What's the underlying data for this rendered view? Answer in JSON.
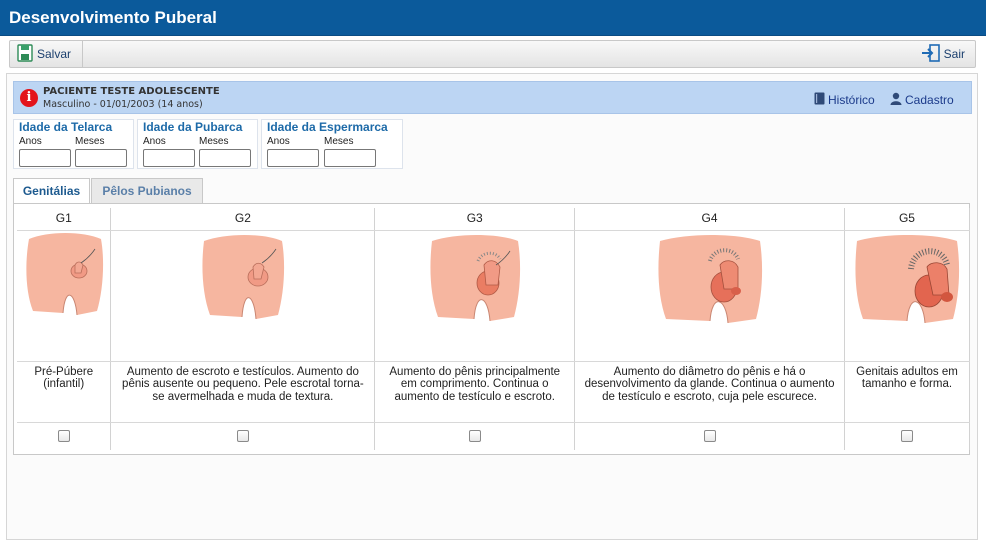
{
  "window": {
    "title": "Desenvolvimento Puberal"
  },
  "toolbar": {
    "save_label": "Salvar",
    "exit_label": "Sair"
  },
  "patient": {
    "name": "PACIENTE TESTE ADOLESCENTE",
    "details": "Masculino - 01/01/2003 (14 anos)",
    "history_label": "Histórico",
    "register_label": "Cadastro"
  },
  "ages": [
    {
      "legend": "Idade da Telarca",
      "years_label": "Anos",
      "months_label": "Meses",
      "years_value": "",
      "months_value": ""
    },
    {
      "legend": "Idade da Pubarca",
      "years_label": "Anos",
      "months_label": "Meses",
      "years_value": "",
      "months_value": ""
    },
    {
      "legend": "Idade da Espermarca",
      "years_label": "Anos",
      "months_label": "Meses",
      "years_value": "",
      "months_value": ""
    }
  ],
  "tabs": [
    {
      "label": "Genitálias",
      "active": true
    },
    {
      "label": "Pêlos Pubianos",
      "active": false
    }
  ],
  "stages": [
    {
      "header": "G1",
      "description": "Pré-Púbere (infantil)",
      "checked": false
    },
    {
      "header": "G2",
      "description": "Aumento de escroto e testículos. Aumento do pênis ausente ou pequeno. Pele escrotal torna-se avermelhada e muda de textura.",
      "checked": false
    },
    {
      "header": "G3",
      "description": "Aumento do pênis principalmente em comprimento. Continua o aumento de testículo e escroto.",
      "checked": false
    },
    {
      "header": "G4",
      "description": "Aumento do diâmetro do pênis e há o desenvolvimento da glande. Continua o aumento de testículo e escroto, cuja pele escurece.",
      "checked": false
    },
    {
      "header": "G5",
      "description": "Genitais adultos em tamanho e forma.",
      "checked": false
    }
  ],
  "colors": {
    "titlebar": "#0b5a9b",
    "patient_banner": "#bcd5f3",
    "info_icon": "#e3141c",
    "tab_text": "#1d5a8f",
    "skin": "#f6b6a0"
  },
  "icons": {
    "save": "save-icon",
    "exit": "exit-icon",
    "info": "info-icon",
    "history": "book-icon",
    "register": "user-icon"
  }
}
